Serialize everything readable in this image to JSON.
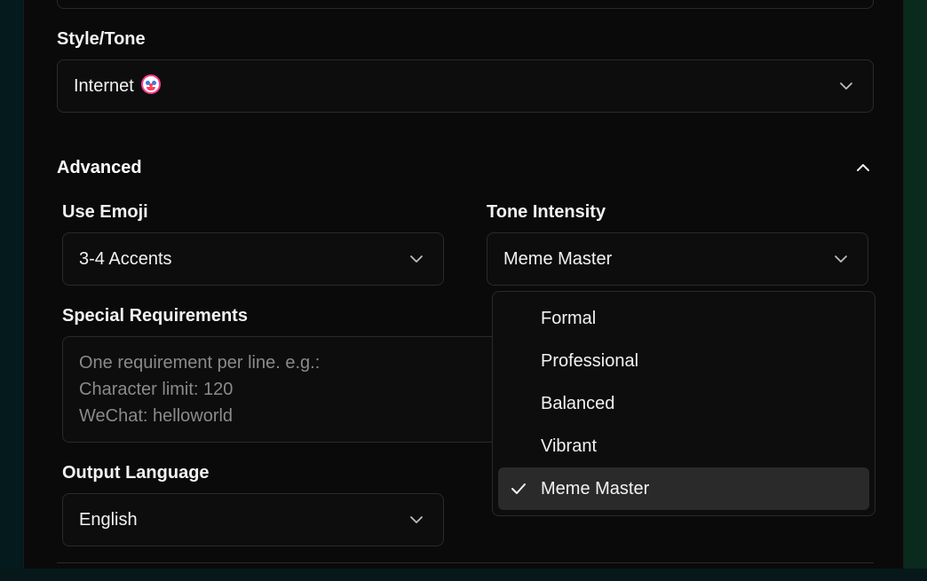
{
  "style_tone": {
    "label": "Style/Tone",
    "value": "Internet",
    "emoji_icon": "clown-face-icon"
  },
  "advanced": {
    "title": "Advanced",
    "collapse_icon": "chevron-up-icon"
  },
  "use_emoji": {
    "label": "Use Emoji",
    "value": "3-4 Accents"
  },
  "tone_intensity": {
    "label": "Tone Intensity",
    "value": "Meme Master",
    "options": [
      {
        "label": "Formal",
        "selected": false
      },
      {
        "label": "Professional",
        "selected": false
      },
      {
        "label": "Balanced",
        "selected": false
      },
      {
        "label": "Vibrant",
        "selected": false
      },
      {
        "label": "Meme Master",
        "selected": true
      }
    ]
  },
  "special_requirements": {
    "label": "Special Requirements",
    "placeholder_lines": [
      "One requirement per line. e.g.:",
      "Character limit: 120",
      "WeChat: helloworld"
    ]
  },
  "output_language": {
    "label": "Output Language",
    "value": "English"
  },
  "colors": {
    "panel_bg": "#0a0a0a",
    "border": "#2a2a2a",
    "selected_option_bg": "#2a2a2a",
    "placeholder_text": "#8a8a8a"
  }
}
